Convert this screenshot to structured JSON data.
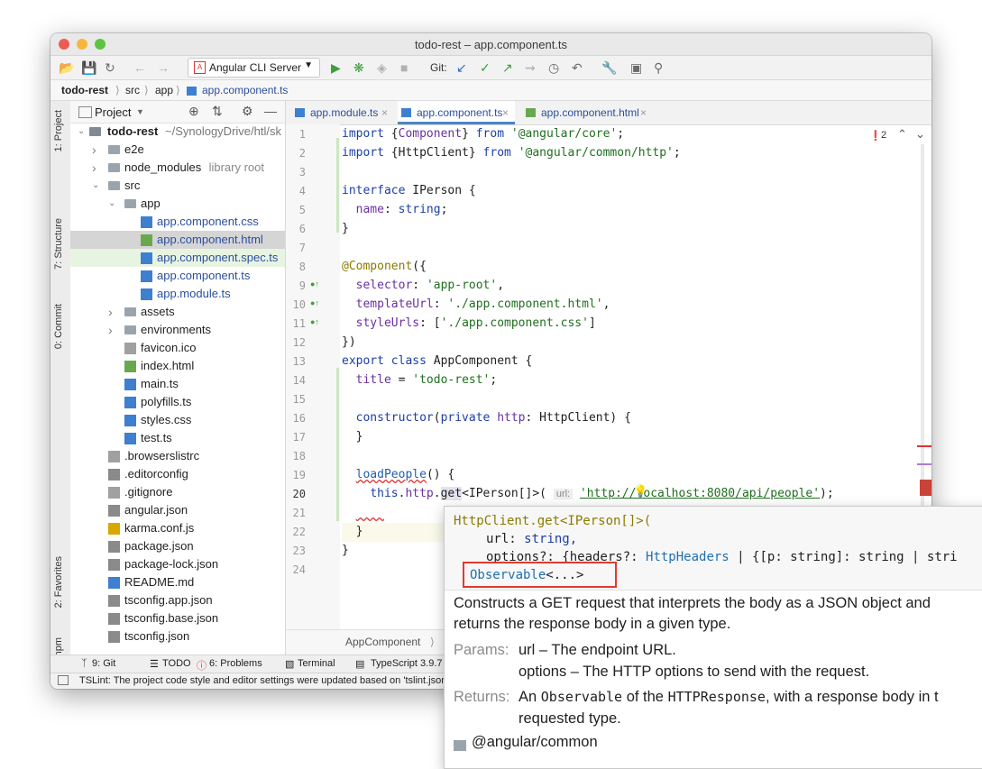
{
  "window": {
    "title": "todo-rest – app.component.ts"
  },
  "toolbar": {
    "run_config": "Angular CLI Server",
    "git_label": "Git:"
  },
  "breadcrumbs": [
    "todo-rest",
    "src",
    "app",
    "app.component.ts"
  ],
  "left_strip": {
    "tabs": [
      "1: Project",
      "7: Structure",
      "0: Commit",
      "2: Favorites",
      "npm"
    ]
  },
  "project": {
    "header": "Project",
    "root_name": "todo-rest",
    "root_path": "~/SynologyDrive/htl/sk",
    "items": [
      {
        "label": "e2e",
        "type": "folder",
        "depth": 1,
        "expandable": true
      },
      {
        "label": "node_modules",
        "suffix": "library root",
        "type": "folder",
        "depth": 1,
        "expandable": true
      },
      {
        "label": "src",
        "type": "folder",
        "depth": 1,
        "expanded": true
      },
      {
        "label": "app",
        "type": "folder",
        "depth": 2,
        "expanded": true
      },
      {
        "label": "app.component.css",
        "type": "css",
        "depth": 3
      },
      {
        "label": "app.component.html",
        "type": "html",
        "depth": 3,
        "selected": true
      },
      {
        "label": "app.component.spec.ts",
        "type": "ts",
        "depth": 3
      },
      {
        "label": "app.component.ts",
        "type": "ts",
        "depth": 3
      },
      {
        "label": "app.module.ts",
        "type": "ts",
        "depth": 3
      },
      {
        "label": "assets",
        "type": "folder",
        "depth": 2,
        "expandable": true
      },
      {
        "label": "environments",
        "type": "folder",
        "depth": 2,
        "expandable": true
      },
      {
        "label": "favicon.ico",
        "type": "file",
        "depth": 2
      },
      {
        "label": "index.html",
        "type": "html",
        "depth": 2
      },
      {
        "label": "main.ts",
        "type": "ts",
        "depth": 2
      },
      {
        "label": "polyfills.ts",
        "type": "ts",
        "depth": 2
      },
      {
        "label": "styles.css",
        "type": "css",
        "depth": 2
      },
      {
        "label": "test.ts",
        "type": "ts",
        "depth": 2
      },
      {
        "label": ".browserslistrc",
        "type": "file",
        "depth": 1
      },
      {
        "label": ".editorconfig",
        "type": "gear",
        "depth": 1
      },
      {
        "label": ".gitignore",
        "type": "file",
        "depth": 1
      },
      {
        "label": "angular.json",
        "type": "json",
        "depth": 1
      },
      {
        "label": "karma.conf.js",
        "type": "js",
        "depth": 1
      },
      {
        "label": "package.json",
        "type": "json",
        "depth": 1
      },
      {
        "label": "package-lock.json",
        "type": "json",
        "depth": 1
      },
      {
        "label": "README.md",
        "type": "md",
        "depth": 1
      },
      {
        "label": "tsconfig.app.json",
        "type": "json",
        "depth": 1
      },
      {
        "label": "tsconfig.base.json",
        "type": "json",
        "depth": 1
      },
      {
        "label": "tsconfig.json",
        "type": "json",
        "depth": 1
      }
    ]
  },
  "editor": {
    "tabs": [
      {
        "label": "app.module.ts",
        "type": "ts"
      },
      {
        "label": "app.component.ts",
        "type": "ts",
        "active": true
      },
      {
        "label": "app.component.html",
        "type": "html"
      }
    ],
    "problem_count": "2",
    "line_numbers": [
      "1",
      "2",
      "3",
      "4",
      "5",
      "6",
      "7",
      "8",
      "9",
      "10",
      "11",
      "12",
      "13",
      "14",
      "15",
      "16",
      "17",
      "18",
      "19",
      "20",
      "21",
      "22",
      "23",
      "24"
    ],
    "hint_label": "url:",
    "footer_label": "AppComponent"
  },
  "bottom_bar": {
    "items": [
      "9: Git",
      "TODO",
      "6: Problems",
      "Terminal",
      "TypeScript 3.9.7"
    ]
  },
  "status": {
    "message": "TSLint: The project code style and editor settings were updated based on 'tslint.json'"
  },
  "popup": {
    "sig_line1": "HttpClient.get<IPerson[]>(",
    "sig_line2_name": "url:",
    "sig_line2_type": "string,",
    "sig_line3_name": "options?: {headers?:",
    "sig_line3_type": "HttpHeaders",
    "sig_line3_rest": "| {[p: string]: string | stri",
    "return_type": "Observable",
    "return_rest": "<...>",
    "description_1": "Constructs a GET request that interprets the body as a JSON object and",
    "description_2": "returns the response body in a given type.",
    "params_label": "Params:",
    "param_1": "url – The endpoint URL.",
    "param_2": "options – The HTTP options to send with the request.",
    "returns_label": "Returns:",
    "returns_1a": "An",
    "returns_1b": "Observable",
    "returns_1c": "of the",
    "returns_1d": "HTTPResponse",
    "returns_1e": ", with a response body in t",
    "returns_2": "requested type.",
    "module": "@angular/common"
  },
  "colors": {
    "accent": "#4a86c8",
    "highlight_box": "#e03b2f",
    "selected_row": "#d5d5d5"
  }
}
